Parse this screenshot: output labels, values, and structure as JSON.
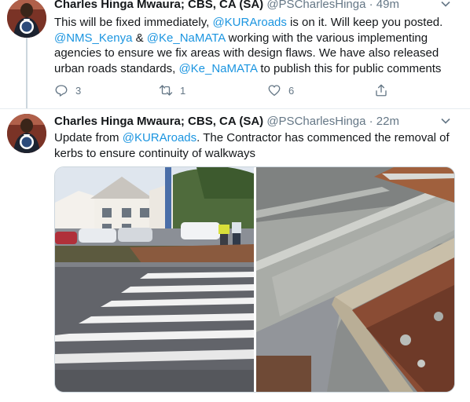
{
  "tweet1": {
    "name": "Charles Hinga Mwaura; CBS, CA (SA)",
    "handle": "@PSCharlesHinga",
    "separator": "·",
    "time": "49m",
    "text": {
      "l1_a": "This will be fixed immediately, ",
      "l1_link": "@KURAroads",
      "l1_b": " is on it. Will keep you posted.",
      "l2_link1": "@NMS_Kenya",
      "l2_amp": " & ",
      "l2_link2": "@Ke_NaMATA",
      "l2_b": " working with the various implementing",
      "l3": "agencies to ensure we fix areas with design flaws. We have also released",
      "l4_a": "urban roads standards, ",
      "l4_link": "@Ke_NaMATA",
      "l4_b": " to publish this for public comments"
    },
    "actions": {
      "reply_count": "3",
      "retweet_count": "1",
      "like_count": "6"
    }
  },
  "tweet2": {
    "name": "Charles Hinga Mwaura; CBS, CA (SA)",
    "handle": "@PSCharlesHinga",
    "separator": "·",
    "time": "22m",
    "text": {
      "l1_a": "Update from ",
      "l1_link": "@KURAroads",
      "l1_b": ". The Contractor has commenced the removal of",
      "l2": "kerbs to ensure continuity of walkways"
    }
  },
  "colors": {
    "link": "#1b95e0",
    "secondary_text": "#657786",
    "primary_text": "#14171a",
    "thread_line": "#ccd6dd"
  },
  "icons": [
    "reply-icon",
    "retweet-icon",
    "like-icon",
    "share-icon",
    "chevron-down-icon"
  ]
}
